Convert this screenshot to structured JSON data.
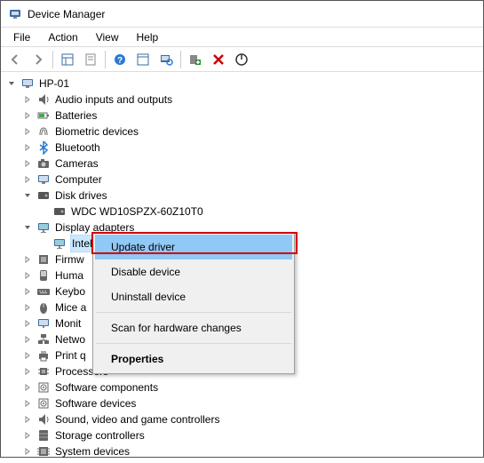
{
  "window": {
    "title": "Device Manager"
  },
  "menubar": {
    "file": "File",
    "action": "Action",
    "view": "View",
    "help": "Help"
  },
  "tree": {
    "root": "HP-01",
    "items": [
      {
        "label": "Audio inputs and outputs",
        "icon": "audio"
      },
      {
        "label": "Batteries",
        "icon": "battery"
      },
      {
        "label": "Biometric devices",
        "icon": "biometric"
      },
      {
        "label": "Bluetooth",
        "icon": "bluetooth"
      },
      {
        "label": "Cameras",
        "icon": "camera"
      },
      {
        "label": "Computer",
        "icon": "computer"
      },
      {
        "label": "Disk drives",
        "icon": "disk",
        "expanded": true,
        "children": [
          {
            "label": "WDC WD10SPZX-60Z10T0",
            "icon": "disk"
          }
        ]
      },
      {
        "label": "Display adapters",
        "icon": "display",
        "expanded": true,
        "children": [
          {
            "label": "Intel(R) UHD Graphics",
            "icon": "display",
            "selected": true
          }
        ]
      },
      {
        "label": "Firmw",
        "icon": "firmware",
        "truncated": true
      },
      {
        "label": "Huma",
        "icon": "hid",
        "truncated": true
      },
      {
        "label": "Keybo",
        "icon": "keyboard",
        "truncated": true
      },
      {
        "label": "Mice a",
        "icon": "mouse",
        "truncated": true
      },
      {
        "label": "Monit",
        "icon": "monitor",
        "truncated": true
      },
      {
        "label": "Netwo",
        "icon": "network",
        "truncated": true
      },
      {
        "label": "Print q",
        "icon": "printer",
        "truncated": true
      },
      {
        "label": "Processors",
        "icon": "processor"
      },
      {
        "label": "Software components",
        "icon": "software"
      },
      {
        "label": "Software devices",
        "icon": "software"
      },
      {
        "label": "Sound, video and game controllers",
        "icon": "sound"
      },
      {
        "label": "Storage controllers",
        "icon": "storage"
      },
      {
        "label": "System devices",
        "icon": "system"
      }
    ]
  },
  "context_menu": {
    "update": "Update driver",
    "disable": "Disable device",
    "uninstall": "Uninstall device",
    "scan": "Scan for hardware changes",
    "properties": "Properties"
  }
}
